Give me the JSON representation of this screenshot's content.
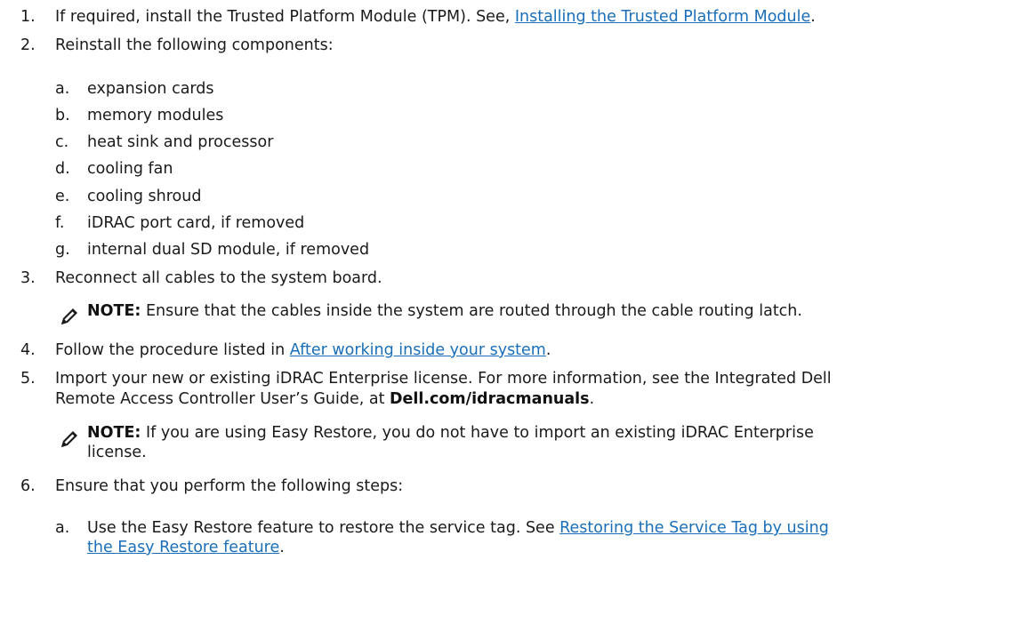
{
  "steps": {
    "s1": {
      "num": "1.",
      "text_before": "If required, install the Trusted Platform Module (TPM). See, ",
      "link": "Installing the Trusted Platform Module",
      "text_after": "."
    },
    "s2": {
      "num": "2.",
      "text": "Reinstall the following components:",
      "items": [
        {
          "letter": "a.",
          "text": "expansion cards"
        },
        {
          "letter": "b.",
          "text": "memory modules"
        },
        {
          "letter": "c.",
          "text": "heat sink and processor"
        },
        {
          "letter": "d.",
          "text": "cooling fan"
        },
        {
          "letter": "e.",
          "text": "cooling shroud"
        },
        {
          "letter": "f.",
          "text": "iDRAC port card, if removed"
        },
        {
          "letter": "g.",
          "text": "internal dual SD module, if removed"
        }
      ]
    },
    "s3": {
      "num": "3.",
      "text": "Reconnect all cables to the system board.",
      "note_label": "NOTE:",
      "note_text": " Ensure that the cables inside the system are routed through the cable routing latch."
    },
    "s4": {
      "num": "4.",
      "text_before": "Follow the procedure listed in ",
      "link": "After working inside your system",
      "text_after": "."
    },
    "s5": {
      "num": "5.",
      "line1": "Import your new or existing iDRAC Enterprise license. For more information, see the Integrated Dell",
      "line2_before": "Remote Access Controller User’s Guide, at ",
      "line2_bold": "Dell.com/idracmanuals",
      "line2_after": ".",
      "note_label": "NOTE:",
      "note_line1": " If you are using Easy Restore, you do not have to import an existing iDRAC Enterprise",
      "note_line2": "license."
    },
    "s6": {
      "num": "6.",
      "text": "Ensure that you perform the following steps:",
      "item_a_letter": "a.",
      "item_a_before": "Use the Easy Restore feature to restore the service tag. See ",
      "item_a_link_line1": "Restoring the Service Tag by using",
      "item_a_link_line2": "the Easy Restore feature",
      "item_a_after": "."
    }
  }
}
